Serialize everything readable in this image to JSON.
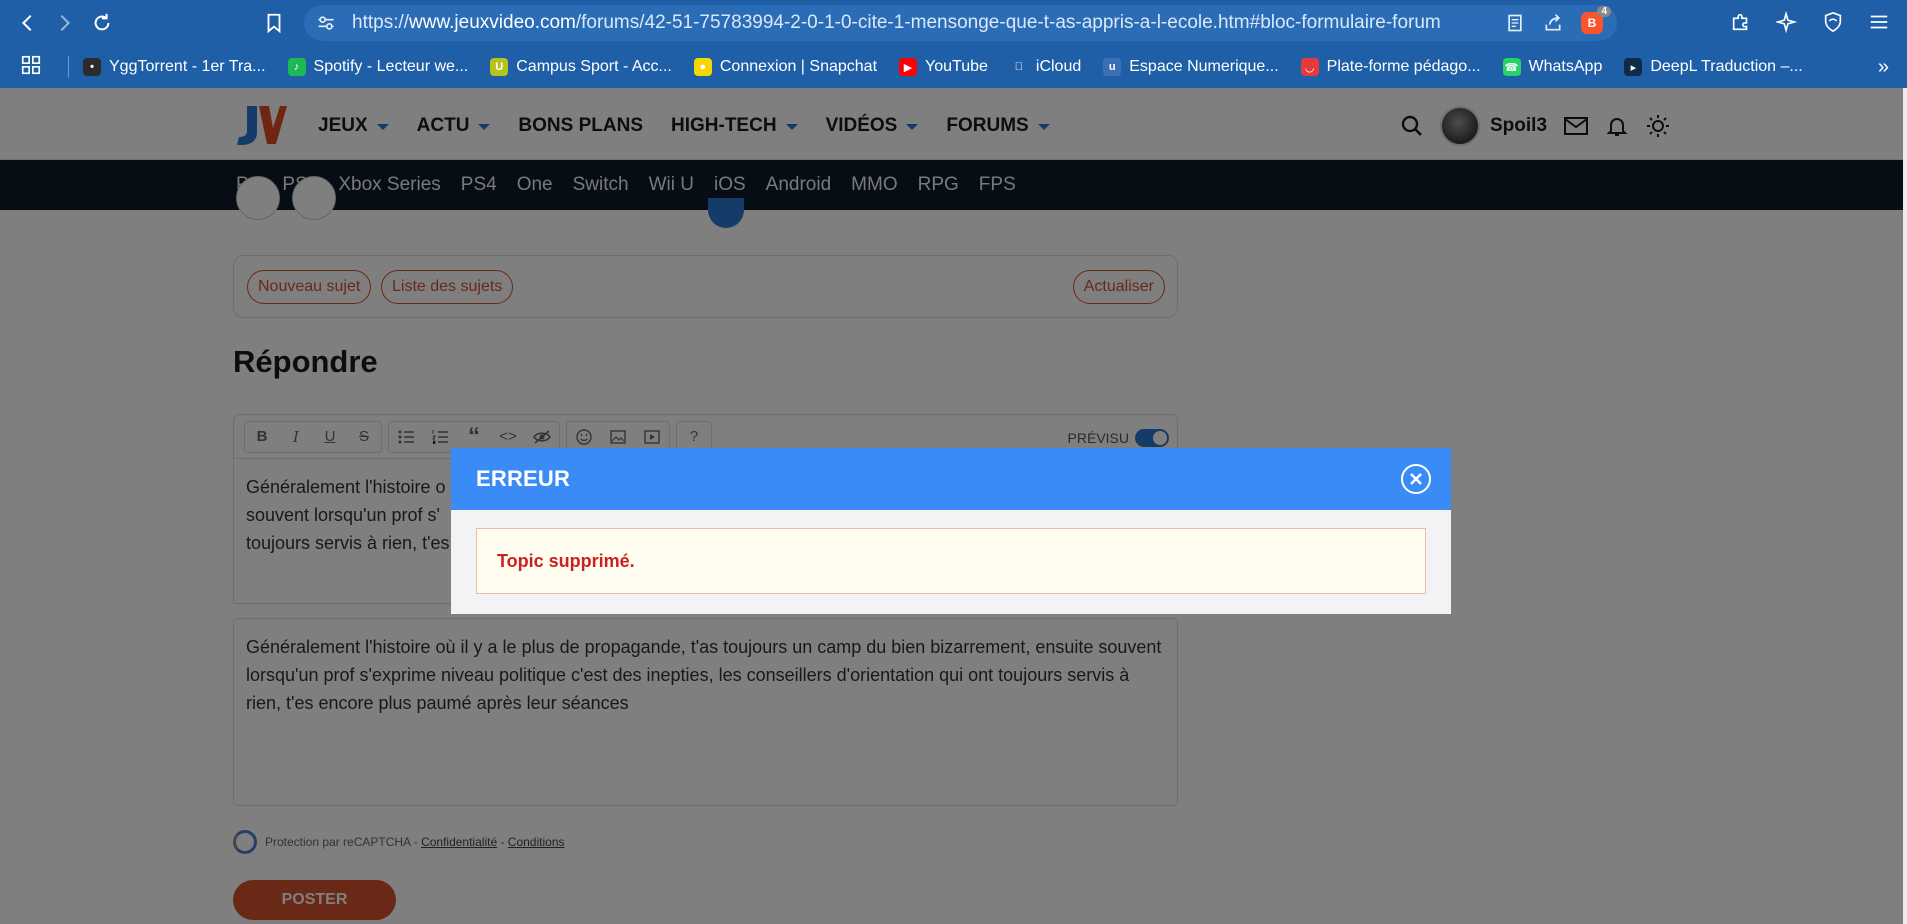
{
  "browser": {
    "url_prefix": "https://",
    "url_domain": "www.jeuxvideo.com",
    "url_path": "/forums/42-51-75783994-2-0-1-0-cite-1-mensonge-que-t-as-appris-a-l-ecole.htm#bloc-formulaire-forum",
    "brave_badge": "4"
  },
  "bookmarks": [
    {
      "label": "YggTorrent - 1er Tra...",
      "color": "#2b2b2b",
      "glyph": "•"
    },
    {
      "label": "Spotify - Lecteur we...",
      "color": "#1db954",
      "glyph": "♪"
    },
    {
      "label": "Campus Sport - Acc...",
      "color": "#b5c41a",
      "glyph": "U"
    },
    {
      "label": "Connexion | Snapchat",
      "color": "#f5d800",
      "glyph": "●"
    },
    {
      "label": "YouTube",
      "color": "#ff0000",
      "glyph": "▶"
    },
    {
      "label": "iCloud",
      "color": "#1f5fa8",
      "glyph": ""
    },
    {
      "label": "Espace Numerique...",
      "color": "#3d6fb6",
      "glyph": "u"
    },
    {
      "label": "Plate-forme pédago...",
      "color": "#e63a3a",
      "glyph": "◡"
    },
    {
      "label": "WhatsApp",
      "color": "#25d366",
      "glyph": "☎"
    },
    {
      "label": "DeepL Traduction –...",
      "color": "#0f2b46",
      "glyph": "▸"
    }
  ],
  "site": {
    "menu": [
      {
        "label": "JEUX",
        "caret": true
      },
      {
        "label": "ACTU",
        "caret": true
      },
      {
        "label": "BONS PLANS",
        "caret": false
      },
      {
        "label": "HIGH-TECH",
        "caret": true
      },
      {
        "label": "VIDÉOS",
        "caret": true
      },
      {
        "label": "FORUMS",
        "caret": true
      }
    ],
    "username": "Spoil3",
    "platforms": [
      "PC",
      "PS5",
      "Xbox Series",
      "PS4",
      "One",
      "Switch",
      "Wii U",
      "iOS",
      "Android",
      "MMO",
      "RPG",
      "FPS"
    ]
  },
  "forum": {
    "new_topic": "Nouveau sujet",
    "topic_list": "Liste des sujets",
    "refresh": "Actualiser",
    "reply_title": "Répondre",
    "preview_label": "PRÉVISU",
    "editor_text_lines": [
      "Généralement l'histoire o",
      "souvent lorsqu'un prof s'",
      "toujours servis à rien, t'es"
    ],
    "preview_text": "Généralement l'histoire où il y a le plus de propagande, t'as toujours un camp du bien bizarrement, ensuite souvent lorsqu'un prof s'exprime niveau politique c'est des inepties, les conseillers d'orientation qui ont toujours servis à rien, t'es encore plus paumé après leur séances",
    "captcha_text": "Protection par reCAPTCHA - ",
    "captcha_privacy": "Confidentialité",
    "captcha_sep": " - ",
    "captcha_terms": "Conditions",
    "post_button": "POSTER"
  },
  "modal": {
    "title": "ERREUR",
    "message": "Topic supprimé."
  },
  "colors": {
    "browser": "#1f5fa8",
    "accent_orange": "#d2532c",
    "modal_header": "#3a8bf5",
    "error_text": "#cc1f1f"
  }
}
